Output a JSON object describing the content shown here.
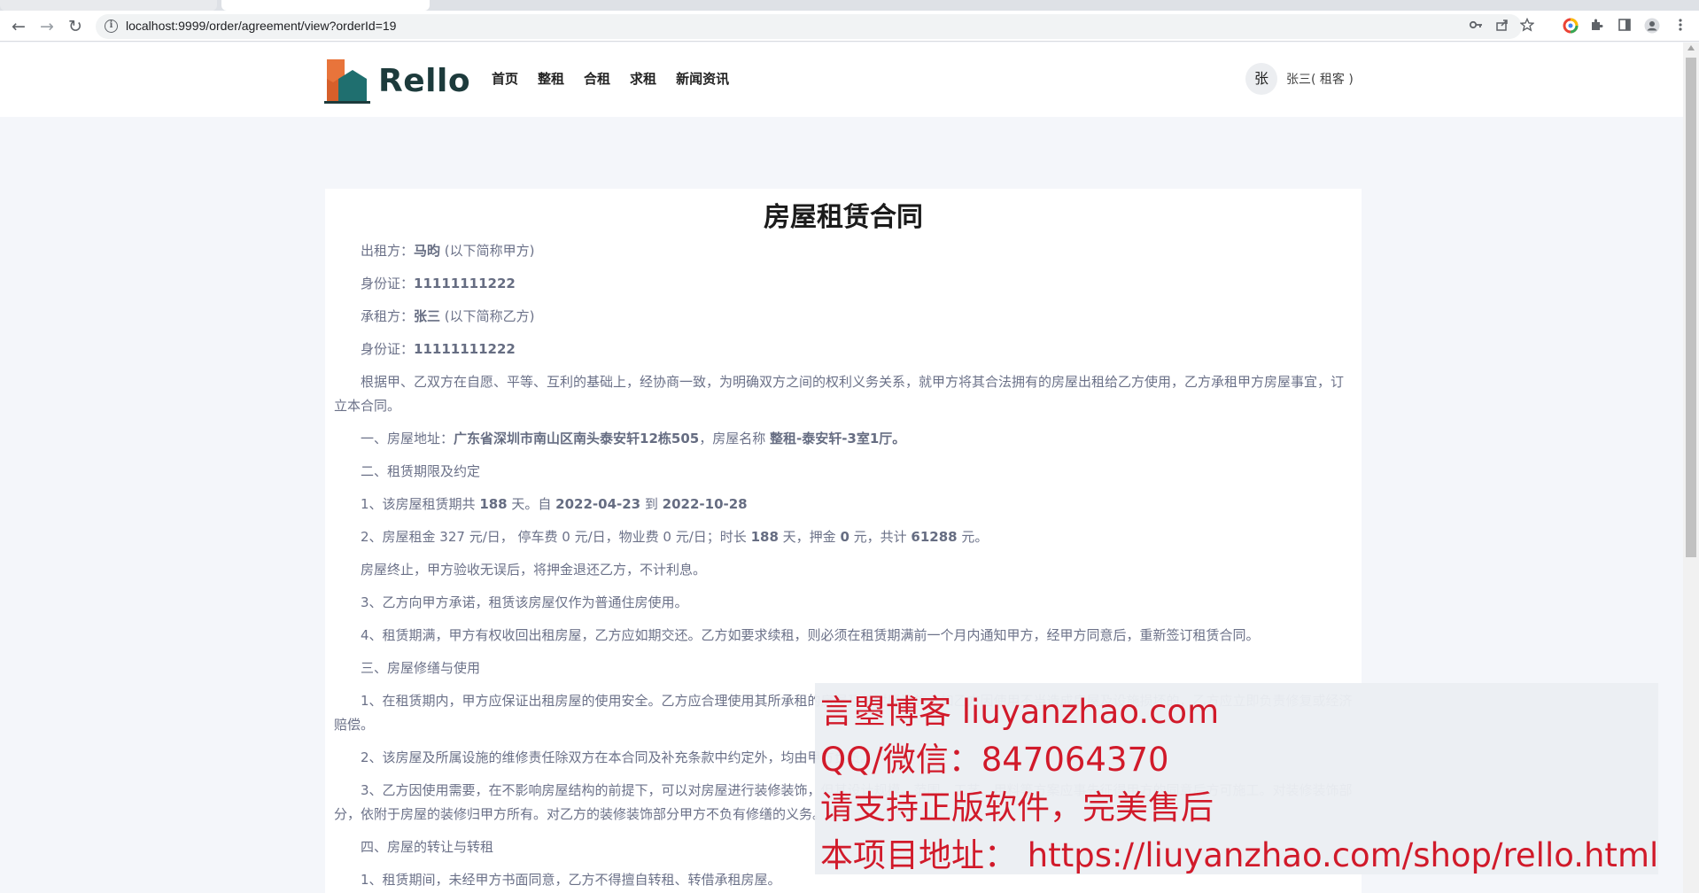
{
  "browser": {
    "url": "localhost:9999/order/agreement/view?orderId=19",
    "nav_back": "←",
    "nav_forward": "→",
    "nav_reload": "↻",
    "info_glyph": "i",
    "icons": [
      "key-icon",
      "share-icon",
      "star-icon",
      "extension-icon",
      "puzzle-icon",
      "sidebar-icon",
      "profile-icon",
      "menu-icon"
    ]
  },
  "site": {
    "logo_text": "Rello",
    "nav": [
      "首页",
      "整租",
      "合租",
      "求租",
      "新闻资讯"
    ],
    "avatar_char": "张",
    "user_name": "张三( 租客 )",
    "colors": {
      "logo_orange": "#e8743b",
      "logo_teal": "#1f6f6f",
      "logo_dark": "#1d3b3c"
    }
  },
  "contract": {
    "title": "房屋租赁合同",
    "lessor_label": "出租方：",
    "lessor_name": "马昀",
    "lessor_suffix": " (以下简称甲方)",
    "lessor_id_label": "身份证：",
    "lessor_id": "11111111222",
    "lessee_label": "承租方：",
    "lessee_name": "张三",
    "lessee_suffix": " (以下简称乙方)",
    "lessee_id_label": "身份证：",
    "lessee_id": "11111111222",
    "preamble": "根据甲、乙双方在自愿、平等、互利的基础上，经协商一致，为明确双方之间的权利义务关系，就甲方将其合法拥有的房屋出租给乙方使用，乙方承租甲方房屋事宜，订立本合同。",
    "s1_prefix": "一、房屋地址：",
    "address": "广东省深圳市南山区南头泰安轩12栋505",
    "s1_mid": "，房屋名称 ",
    "house_name": "整租-泰安轩-3室1厅。",
    "s2_title": "二、租赁期限及约定",
    "s2_1_a": "1、该房屋租赁期共 ",
    "days": "188",
    "s2_1_b": " 天。自 ",
    "start_date": "2022-04-23",
    "s2_1_c": " 到 ",
    "end_date": "2022-10-28",
    "s2_2_a": "2、房屋租金 327 元/日， 停车费 0 元/日，物业费 0 元/日；时长 ",
    "days2": "188",
    "s2_2_b": " 天，押金 ",
    "deposit": "0",
    "s2_2_c": " 元，共计 ",
    "total": "61288",
    "s2_2_d": " 元。",
    "s2_deposit": "房屋终止，甲方验收无误后，将押金退还乙方，不计利息。",
    "s2_3": "3、乙方向甲方承诺，租赁该房屋仅作为普通住房使用。",
    "s2_4": "4、租赁期满，甲方有权收回出租房屋，乙方应如期交还。乙方如要求续租，则必须在租赁期满前一个月内通知甲方，经甲方同意后，重新签订租赁合同。",
    "s3_title": "三、房屋修缮与使用",
    "s3_1": "1、在租赁期内，甲方应保证出租房屋的使用安全。乙方应合理使用其所承租的房屋及其附属设施。如乙方因使用不当造成房屋及设施损坏的，乙方应立即负责修复或经济赔偿。",
    "s3_2": "2、该房屋及所属设施的维修责任除双方在本合同及补充条款中约定外，均由甲方负责。",
    "s3_3": "3、乙方因使用需要，在不影响房屋结构的前提下，可以对房屋进行装修装饰，但其设计规模、范围、工艺、用料等方案应事先征得甲方的同意后方可施工。对装修装饰部分，依附于房屋的装修归甲方所有。对乙方的装修装饰部分甲方不负有修缮的义务。",
    "s4_title": "四、房屋的转让与转租",
    "s4_1": "1、租赁期间，未经甲方书面同意，乙方不得擅自转租、转借承租房屋。"
  },
  "watermark": {
    "line1": "言曌博客 liuyanzhao.com",
    "line2": "QQ/微信：847064370",
    "line3": "请支持正版软件，完美售后",
    "line4": "本项目地址： https://liuyanzhao.com/shop/rello.html",
    "color": "#d11a2a"
  }
}
